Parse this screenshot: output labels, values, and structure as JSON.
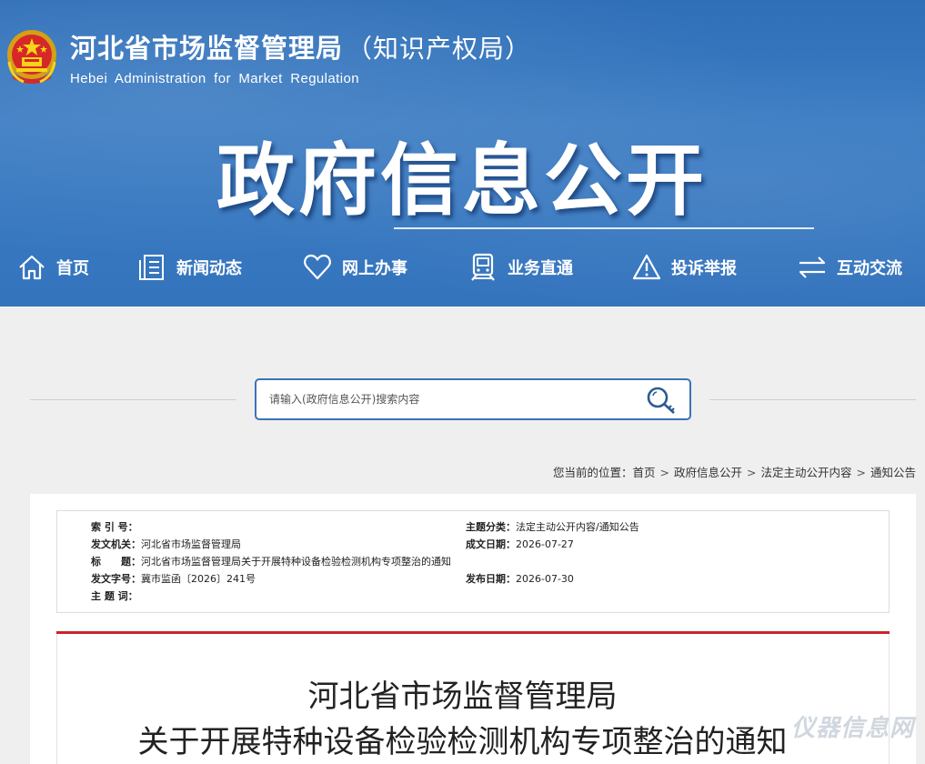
{
  "header": {
    "agency_name_cn": "河北省市场监督管理局",
    "agency_name_suffix": "（知识产权局）",
    "agency_name_en": "Hebei Administration for Market Regulation",
    "banner_title": "政府信息公开"
  },
  "nav": {
    "items": [
      {
        "label": "首页",
        "icon": "home-icon"
      },
      {
        "label": "新闻动态",
        "icon": "news-icon"
      },
      {
        "label": "网上办事",
        "icon": "heart-icon"
      },
      {
        "label": "业务直通",
        "icon": "train-icon"
      },
      {
        "label": "投诉举报",
        "icon": "warning-icon"
      },
      {
        "label": "互动交流",
        "icon": "exchange-icon"
      }
    ]
  },
  "search": {
    "placeholder": "请输入(政府信息公开)搜索内容",
    "icon": "search-key-icon"
  },
  "breadcrumb": {
    "prefix": "您当前的位置：",
    "items": [
      "首页",
      "政府信息公开",
      "法定主动公开内容",
      "通知公告"
    ],
    "separator": ">"
  },
  "meta": {
    "index_key": "索 引 号：",
    "index_value": "",
    "issuer_key": "发文机关：",
    "issuer_value": "河北省市场监督管理局",
    "title_key": "标　　题：",
    "title_value": "河北省市场监督管理局关于开展特种设备检验检测机构专项整治的通知",
    "doc_no_key": "发文字号：",
    "doc_no_value": "冀市监函〔2026〕241号",
    "subject_key": "主 题 词：",
    "subject_value": "",
    "category_key": "主题分类：",
    "category_value": "法定主动公开内容/通知公告",
    "written_key": "成文日期：",
    "written_value": "2026-07-27",
    "published_key": "发布日期：",
    "published_value": "2026-07-30"
  },
  "document": {
    "title_line1": "河北省市场监督管理局",
    "title_line2": "关于开展特种设备检验检测机构专项整治的通知"
  },
  "watermark": "仪器信息网",
  "colors": {
    "header_blue": "#3474bd",
    "search_border": "#3c73b4",
    "red_rule": "#c9242b"
  }
}
